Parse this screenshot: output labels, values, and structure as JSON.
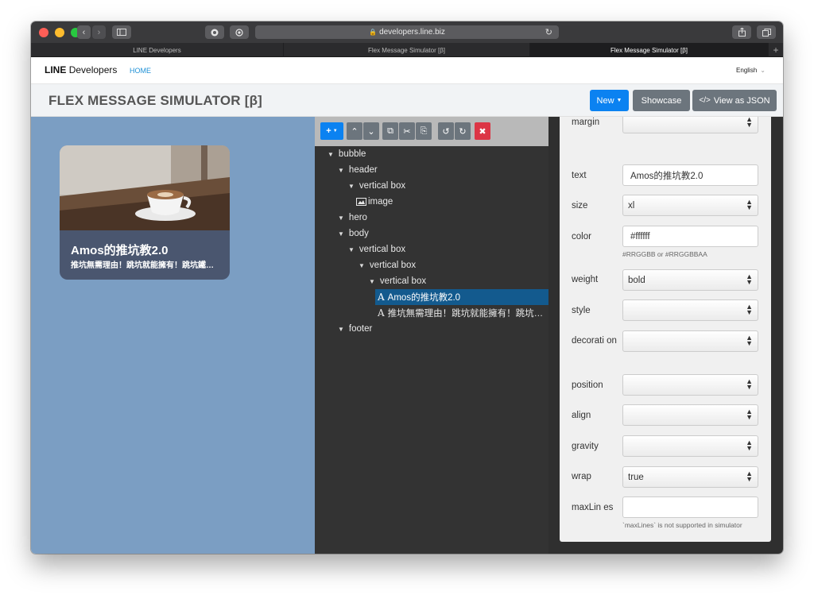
{
  "browser": {
    "url": "developers.line.biz",
    "tabs": [
      "LINE Developers",
      "Flex Message Simulator [β]",
      "Flex Message Simulator [β]"
    ],
    "new_tab": "+"
  },
  "header": {
    "brand_bold": "LINE",
    "brand_rest": "Developers",
    "home": "HOME",
    "language": "English"
  },
  "page": {
    "title": "FLEX MESSAGE SIMULATOR [β]",
    "new_label": "New",
    "showcase_label": "Showcase",
    "json_label": "View as JSON"
  },
  "preview": {
    "title": "Amos的推坑教2.0",
    "subtitle": "推坑無需理由！跳坑就能擁有！跳坑鐵…"
  },
  "tree": {
    "nodes": [
      {
        "label": "bubble",
        "expanded": true
      },
      {
        "label": "header",
        "expanded": true
      },
      {
        "label": "vertical box",
        "expanded": true
      },
      {
        "label": "image",
        "icon": "image-icon"
      },
      {
        "label": "hero",
        "expanded": true
      },
      {
        "label": "body",
        "expanded": true
      },
      {
        "label": "vertical box",
        "expanded": true
      },
      {
        "label": "vertical box",
        "expanded": true
      },
      {
        "label": "vertical box",
        "expanded": true
      },
      {
        "label": "Amos的推坑教2.0",
        "icon": "text-icon",
        "selected": true
      },
      {
        "label": "推坑無需理由！跳坑就能擁有！跳坑…",
        "icon": "text-icon"
      },
      {
        "label": "footer",
        "expanded": true
      }
    ]
  },
  "properties": {
    "margin": {
      "label": "margin",
      "value": ""
    },
    "text": {
      "label": "text",
      "value": "Amos的推坑教2.0"
    },
    "size": {
      "label": "size",
      "value": "xl"
    },
    "color": {
      "label": "color",
      "value": "#ffffff",
      "hint": "#RRGGBB or #RRGGBBAA"
    },
    "weight": {
      "label": "weight",
      "value": "bold"
    },
    "style": {
      "label": "style",
      "value": ""
    },
    "decoration": {
      "label": "decorati on",
      "value": ""
    },
    "position": {
      "label": "position",
      "value": ""
    },
    "align": {
      "label": "align",
      "value": ""
    },
    "gravity": {
      "label": "gravity",
      "value": ""
    },
    "wrap": {
      "label": "wrap",
      "value": "true"
    },
    "maxLines": {
      "label": "maxLin es",
      "value": "",
      "hint": "`maxLines` is not supported in simulator"
    }
  },
  "colors": {
    "accent_blue": "#0b82f1",
    "secondary_gray": "#6c757d",
    "delete_red": "#dc3545",
    "preview_bg": "#7b9ec3",
    "tree_bg": "#333333",
    "selected_node": "#135a8e"
  }
}
